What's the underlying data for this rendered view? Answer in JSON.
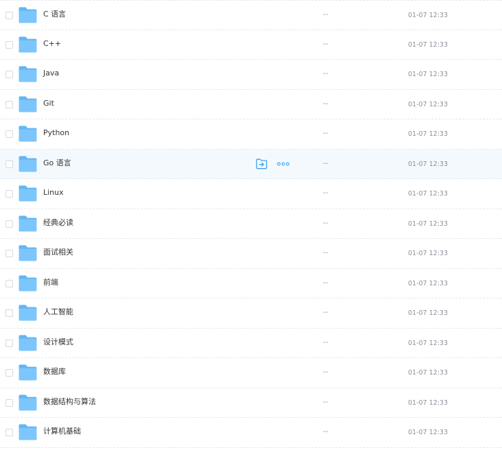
{
  "colors": {
    "folder": "#7cc6fb",
    "folder_tab": "#63b6f4",
    "hover_bg": "#f4f9fe",
    "action_icon": "#3aa0f2",
    "text_primary": "#333333",
    "text_secondary": "#8a8f99"
  },
  "files": [
    {
      "name": "C 语言",
      "size": "--",
      "mtime": "01-07 12:33",
      "icon": "folder-icon",
      "hovered": false
    },
    {
      "name": "C++",
      "size": "--",
      "mtime": "01-07 12:33",
      "icon": "folder-icon",
      "hovered": false
    },
    {
      "name": "Java",
      "size": "--",
      "mtime": "01-07 12:33",
      "icon": "folder-icon",
      "hovered": false
    },
    {
      "name": "Git",
      "size": "--",
      "mtime": "01-07 12:33",
      "icon": "folder-icon",
      "hovered": false
    },
    {
      "name": "Python",
      "size": "--",
      "mtime": "01-07 12:33",
      "icon": "folder-icon",
      "hovered": false
    },
    {
      "name": "Go 语言",
      "size": "--",
      "mtime": "01-07 12:33",
      "icon": "folder-icon",
      "hovered": true
    },
    {
      "name": "Linux",
      "size": "--",
      "mtime": "01-07 12:33",
      "icon": "folder-icon",
      "hovered": false
    },
    {
      "name": "经典必读",
      "size": "--",
      "mtime": "01-07 12:33",
      "icon": "folder-icon",
      "hovered": false
    },
    {
      "name": "面试相关",
      "size": "--",
      "mtime": "01-07 12:33",
      "icon": "folder-icon",
      "hovered": false
    },
    {
      "name": "前端",
      "size": "--",
      "mtime": "01-07 12:33",
      "icon": "folder-icon",
      "hovered": false
    },
    {
      "name": "人工智能",
      "size": "--",
      "mtime": "01-07 12:33",
      "icon": "folder-icon",
      "hovered": false
    },
    {
      "name": "设计模式",
      "size": "--",
      "mtime": "01-07 12:33",
      "icon": "folder-icon",
      "hovered": false
    },
    {
      "name": "数据库",
      "size": "--",
      "mtime": "01-07 12:33",
      "icon": "folder-icon",
      "hovered": false
    },
    {
      "name": "数据结构与算法",
      "size": "--",
      "mtime": "01-07 12:33",
      "icon": "folder-icon",
      "hovered": false
    },
    {
      "name": "计算机基础",
      "size": "--",
      "mtime": "01-07 12:33",
      "icon": "folder-icon",
      "hovered": false
    }
  ],
  "hover_actions": [
    {
      "icon": "move-to-folder-icon"
    },
    {
      "icon": "more-options-icon"
    }
  ]
}
